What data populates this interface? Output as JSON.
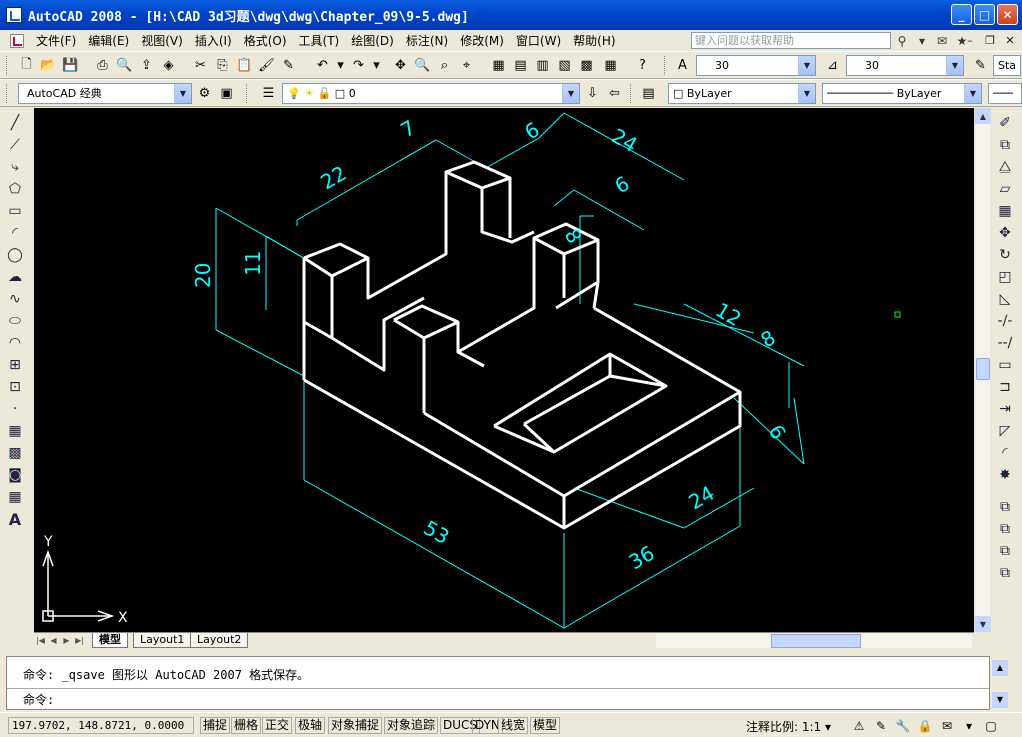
{
  "window": {
    "title": "AutoCAD 2008 - [H:\\CAD  3d习题\\dwg\\dwg\\Chapter_09\\9-5.dwg]",
    "minimize": "_",
    "maximize": "□",
    "close": "✕"
  },
  "menu": {
    "items": [
      "文件(F)",
      "编辑(E)",
      "视图(V)",
      "插入(I)",
      "格式(O)",
      "工具(T)",
      "绘图(D)",
      "标注(N)",
      "修改(M)",
      "窗口(W)",
      "帮助(H)"
    ],
    "help_placeholder": "键入问题以获取帮助"
  },
  "toolbar": {
    "text_height_1": "30",
    "text_height_2": "30",
    "style_text": "Sta",
    "workspace": "AutoCAD 经典",
    "layer": "0",
    "color": "ByLayer",
    "linetype": "ByLayer"
  },
  "drawing": {
    "dims": [
      "7",
      "6",
      "24",
      "22",
      "6",
      "8",
      "20",
      "11",
      "12",
      "8",
      "6",
      "24",
      "53",
      "36"
    ],
    "ucs_x": "X",
    "ucs_y": "Y"
  },
  "tabs": [
    "模型",
    "Layout1",
    "Layout2"
  ],
  "command": {
    "line1": "命令:  _qsave 图形以 AutoCAD 2007 格式保存。",
    "line2": "命令:"
  },
  "status": {
    "coords": "197.9702, 148.8721, 0.0000",
    "toggles": [
      "捕捉",
      "栅格",
      "正交",
      "极轴",
      "对象捕捉",
      "对象追踪",
      "DUCS",
      "DYN",
      "线宽",
      "模型"
    ],
    "annotation_scale": "注释比例: 1:1 ▾"
  },
  "colors": {
    "titlebar": "#0144c8",
    "canvas": "#000000",
    "model_lines": "#ffffff",
    "dim_lines": "#00ffff"
  }
}
